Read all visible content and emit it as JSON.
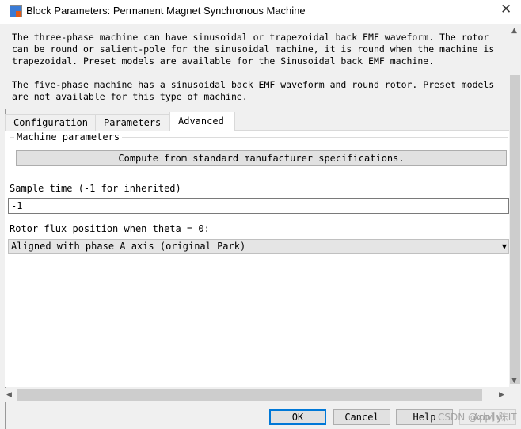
{
  "window": {
    "title": "Block Parameters: Permanent Magnet Synchronous Machine",
    "close_icon": "close-icon"
  },
  "description": {
    "para1": "The three-phase machine can have sinusoidal or trapezoidal back EMF waveform. The rotor\ncan be round or salient-pole for the sinusoidal machine, it is round when the machine is\ntrapezoidal. Preset models are available for the Sinusoidal back EMF machine.",
    "para2": "The five-phase machine has a sinusoidal back EMF waveform and round rotor. Preset models\nare not available for this type of machine."
  },
  "tabs": [
    {
      "label": "Configuration"
    },
    {
      "label": "Parameters"
    },
    {
      "label": "Advanced",
      "active": true
    }
  ],
  "advanced": {
    "group_label": "Machine parameters",
    "compute_button": "Compute from standard manufacturer specifications.",
    "sample_time_label": "Sample time (-1 for inherited)",
    "sample_time_value": "-1",
    "rotor_flux_label": "Rotor flux position when theta = 0:",
    "rotor_flux_value": "Aligned with phase A axis (original Park)"
  },
  "buttons": {
    "ok": "OK",
    "cancel": "Cancel",
    "help": "Help",
    "apply": "Apply"
  },
  "watermark": "CSDN @xb小陈IT",
  "colors": {
    "focus": "#0078d7"
  }
}
